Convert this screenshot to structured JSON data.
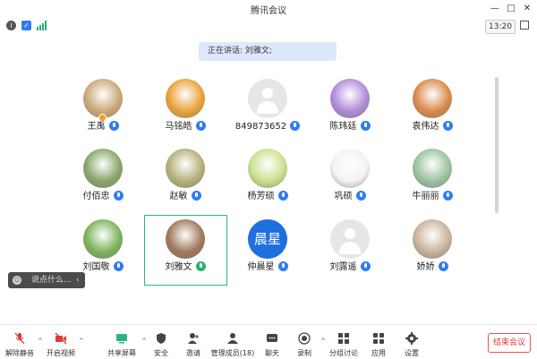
{
  "window": {
    "title": "腾讯会议",
    "controls": [
      "—",
      "□",
      "✕"
    ]
  },
  "infobar": {
    "timer": "13:20"
  },
  "speaker_banner": "正在讲话: 刘雅文;",
  "participants": [
    {
      "name": "王禹",
      "avatar_type": "photo",
      "avatar_color": "#c9a979",
      "mic": "none",
      "host": true
    },
    {
      "name": "马铭皓",
      "avatar_type": "photo",
      "avatar_color": "#e8a33a",
      "mic": "blue",
      "host": false
    },
    {
      "name": "849873652",
      "avatar_type": "placeholder",
      "avatar_color": "#e6e6e6",
      "mic": "blue",
      "host": false
    },
    {
      "name": "陈玮廷",
      "avatar_type": "photo",
      "avatar_color": "#b08bd8",
      "mic": "blue",
      "host": false
    },
    {
      "name": "袁伟达",
      "avatar_type": "photo",
      "avatar_color": "#d98a4a",
      "mic": "blue",
      "host": false
    },
    {
      "name": "付佰忠",
      "avatar_type": "photo",
      "avatar_color": "#8aa66a",
      "mic": "blue",
      "host": false
    },
    {
      "name": "赵敏",
      "avatar_type": "photo",
      "avatar_color": "#b5b07a",
      "mic": "blue",
      "host": false
    },
    {
      "name": "杨芳硕",
      "avatar_type": "photo",
      "avatar_color": "#cbe08f",
      "mic": "blue",
      "host": false
    },
    {
      "name": "巩硕",
      "avatar_type": "photo",
      "avatar_color": "#f3f3f3",
      "mic": "blue",
      "host": false
    },
    {
      "name": "牛丽丽",
      "avatar_type": "photo",
      "avatar_color": "#9bc2a0",
      "mic": "blue",
      "host": false
    },
    {
      "name": "刘国敬",
      "avatar_type": "photo",
      "avatar_color": "#7db35a",
      "mic": "blue",
      "host": false
    },
    {
      "name": "刘雅文",
      "avatar_type": "photo",
      "avatar_color": "#a2785c",
      "mic": "green",
      "host": false
    },
    {
      "name": "仲晨星",
      "avatar_type": "text",
      "avatar_text": "晨星",
      "avatar_color": "#1f6fde",
      "mic": "blue",
      "host": false
    },
    {
      "name": "刘露遥",
      "avatar_type": "placeholder",
      "avatar_color": "#e6e6e6",
      "mic": "blue",
      "host": false
    },
    {
      "name": "娇娇",
      "avatar_type": "photo",
      "avatar_color": "#c9b39a",
      "mic": "blue",
      "host": false
    }
  ],
  "chat_input": {
    "placeholder": "说点什么...",
    "collapse_glyph": "‹"
  },
  "toolbar": {
    "items": [
      {
        "label": "解除静音",
        "icon": "mic-muted-icon",
        "color": "#e03a3a"
      },
      {
        "label": "开启视频",
        "icon": "video-off-icon",
        "color": "#e03a3a"
      },
      {
        "label": "共享屏幕",
        "icon": "share-screen-icon",
        "color": "#2cb57c"
      },
      {
        "label": "安全",
        "icon": "shield-icon",
        "color": "#444444"
      },
      {
        "label": "邀请",
        "icon": "invite-icon",
        "color": "#444444"
      },
      {
        "label": "管理成员(18)",
        "icon": "members-icon",
        "color": "#444444"
      },
      {
        "label": "聊天",
        "icon": "chat-icon",
        "color": "#444444"
      },
      {
        "label": "录制",
        "icon": "record-icon",
        "color": "#444444"
      },
      {
        "label": "分组讨论",
        "icon": "breakout-icon",
        "color": "#444444"
      },
      {
        "label": "应用",
        "icon": "apps-icon",
        "color": "#444444"
      },
      {
        "label": "设置",
        "icon": "gear-icon",
        "color": "#444444"
      }
    ],
    "end_button": "结束会议"
  }
}
